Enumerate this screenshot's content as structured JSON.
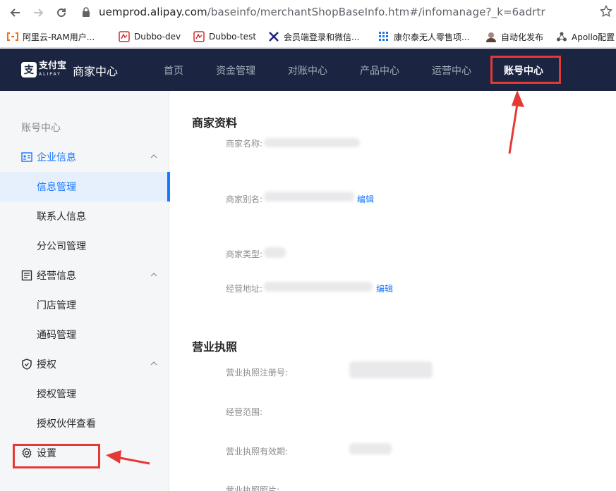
{
  "browser": {
    "url_host": "uemprod.alipay.com",
    "url_path": "/baseinfo/merchantShopBaseInfo.htm#/infomanage?_k=6adrtr",
    "bookmarks": [
      {
        "label": "阿里云-RAM用户...",
        "icon": "aliyun-icon"
      },
      {
        "label": "Dubbo-dev",
        "icon": "dubbo-icon"
      },
      {
        "label": "Dubbo-test",
        "icon": "dubbo-icon"
      },
      {
        "label": "会员端登录和微信...",
        "icon": "tools-icon"
      },
      {
        "label": "康尔泰无人零售项...",
        "icon": "grid-icon"
      },
      {
        "label": "自动化发布",
        "icon": "avatar-icon"
      },
      {
        "label": "Apollo配置",
        "icon": "apollo-icon"
      }
    ]
  },
  "header": {
    "logo_text": "支付宝",
    "logo_sub": "ALIPAY",
    "title": "商家中心",
    "menu": [
      "首页",
      "资金管理",
      "对账中心",
      "产品中心",
      "运营中心",
      "账号中心"
    ],
    "active_index": 5
  },
  "sidebar": {
    "title": "账号中心",
    "groups": [
      {
        "label": "企业信息",
        "items": [
          "信息管理",
          "联系人信息",
          "分公司管理"
        ]
      },
      {
        "label": "经营信息",
        "items": [
          "门店管理",
          "通码管理"
        ]
      },
      {
        "label": "授权",
        "items": [
          "授权管理",
          "授权伙伴查看"
        ]
      }
    ],
    "settings_label": "设置",
    "selected_item": "信息管理"
  },
  "main": {
    "merchant_section": {
      "title": "商家资料",
      "fields": [
        {
          "label": "商家名称:"
        },
        {
          "label": "商家别名:",
          "action": "编辑"
        },
        {
          "label": "商家类型:"
        },
        {
          "label": "经营地址:",
          "action": "编辑"
        }
      ]
    },
    "license_section": {
      "title": "营业执照",
      "fields": [
        {
          "label": "营业执照注册号:"
        },
        {
          "label": "经营范围:"
        },
        {
          "label": "营业执照有效期:"
        },
        {
          "label": "营业执照照片:"
        }
      ]
    }
  },
  "colors": {
    "nav_bg": "#1b2440",
    "accent": "#1677ff",
    "annotation_red": "#e53935"
  }
}
